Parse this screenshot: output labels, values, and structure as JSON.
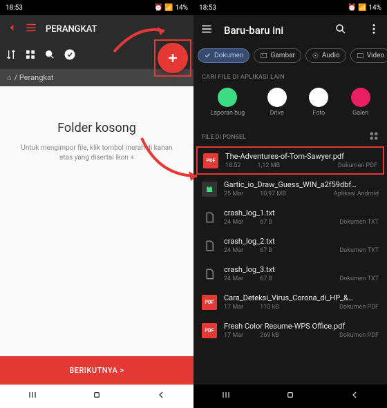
{
  "statusbar": {
    "time": "18:53",
    "battery": "14%"
  },
  "left": {
    "header_title": "PERANGKAT",
    "breadcrumb_home": "⌂",
    "breadcrumb_path": "/  Perangkat",
    "empty_title": "Folder kosong",
    "empty_sub": "Untuk mengimpor file, klik tombol merah di kanan atas yang disertai ikon +",
    "next_btn": "BERIKUTNYA  >"
  },
  "right": {
    "title": "Baru-baru ini",
    "chips": [
      {
        "label": "Dokumen",
        "active": true,
        "icon": "check"
      },
      {
        "label": "Gambar",
        "active": false,
        "icon": "image"
      },
      {
        "label": "Audio",
        "active": false,
        "icon": "audio"
      },
      {
        "label": "Video",
        "active": false,
        "icon": "video"
      }
    ],
    "section_apps": "CARI FILE DI APLIKASI LAIN",
    "apps": [
      {
        "label": "Laporan bug",
        "color": "#3ddc84"
      },
      {
        "label": "Drive",
        "color": "#fff"
      },
      {
        "label": "Foto",
        "color": "#fff"
      },
      {
        "label": "Galeri",
        "color": "#e91e63"
      }
    ],
    "section_files": "FILE DI PONSEL",
    "files": [
      {
        "name": "The-Adventures-of-Tom-Sawyer.pdf",
        "date": "18:52",
        "size": "1,12 MB",
        "type": "Dokumen PDF",
        "kind": "pdf",
        "hl": true
      },
      {
        "name": "Gartic_io_Draw_Guess_WIN_a2f59dbf…",
        "date": "25 Mar",
        "size": "10,97 MB",
        "type": "Aplikasi Android",
        "kind": "apk"
      },
      {
        "name": "crash_log_1.txt",
        "date": "24 Mar",
        "size": "67 B",
        "type": "Dokumen TXT",
        "kind": "txt"
      },
      {
        "name": "crash_log_2.txt",
        "date": "24 Mar",
        "size": "67 B",
        "type": "Dokumen TXT",
        "kind": "txt"
      },
      {
        "name": "crash_log_3.txt",
        "date": "24 Mar",
        "size": "67 B",
        "type": "Dokumen TXT",
        "kind": "txt"
      },
      {
        "name": "Cara_Deteksi_Virus_Corona_di_HP_&…",
        "date": "17 Mar",
        "size": "110 kB",
        "type": "Dokumen PDF",
        "kind": "pdf"
      },
      {
        "name": "Fresh Color Resume-WPS Office.pdf",
        "date": "17 Mar",
        "size": "269 kB",
        "type": "Dokumen PDF",
        "kind": "pdf"
      }
    ]
  }
}
